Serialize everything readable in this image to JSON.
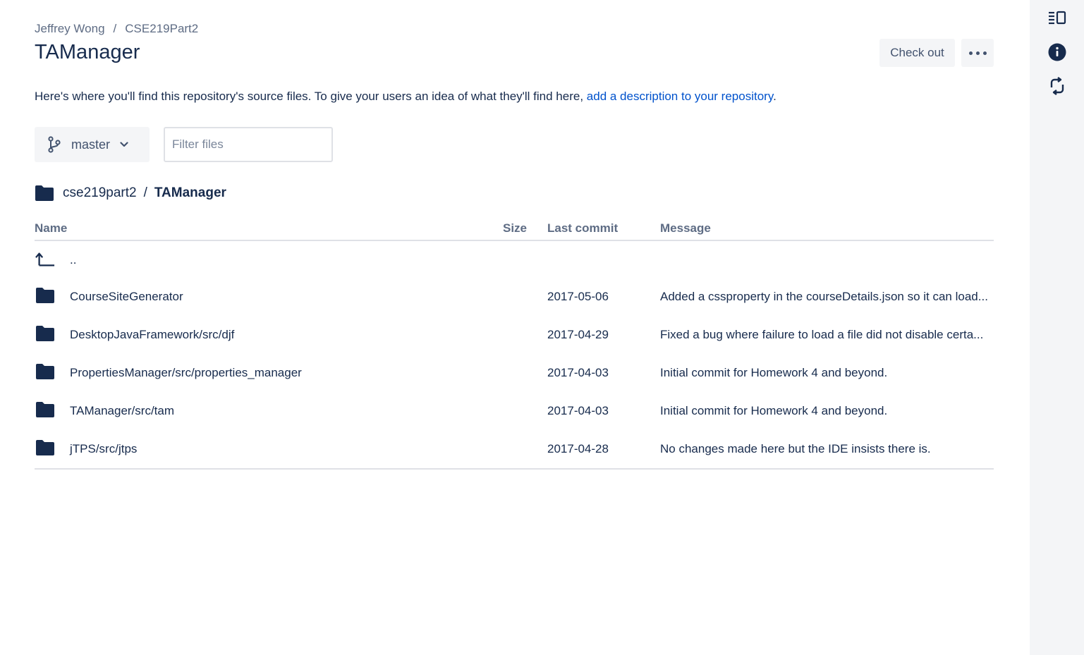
{
  "breadcrumb": {
    "owner": "Jeffrey Wong",
    "separator": "/",
    "project": "CSE219Part2"
  },
  "page_title": "TAManager",
  "actions": {
    "checkout_label": "Check out",
    "more_icon": "more-horizontal-icon"
  },
  "description": {
    "text": "Here's where you'll find this repository's source files. To give your users an idea of what they'll find here, ",
    "link": "add a description to your repository",
    "suffix": "."
  },
  "branch": {
    "icon": "branch-icon",
    "label": "master",
    "chevron": "chevron-down-icon"
  },
  "filter": {
    "placeholder": "Filter files",
    "value": ""
  },
  "path": {
    "root": "cse219part2",
    "separator": "/",
    "current": "TAManager"
  },
  "table": {
    "headers": {
      "name": "Name",
      "size": "Size",
      "last_commit": "Last commit",
      "message": "Message"
    },
    "parent_row": {
      "label": ".."
    },
    "rows": [
      {
        "name": "CourseSiteGenerator",
        "size": "",
        "date": "2017-05-06",
        "message": "Added a cssproperty in the courseDetails.json so it can load..."
      },
      {
        "name": "DesktopJavaFramework/src/djf",
        "size": "",
        "date": "2017-04-29",
        "message": "Fixed a bug where failure to load a file did not disable certa..."
      },
      {
        "name": "PropertiesManager/src/properties_manager",
        "size": "",
        "date": "2017-04-03",
        "message": "Initial commit for Homework 4 and beyond."
      },
      {
        "name": "TAManager/src/tam",
        "size": "",
        "date": "2017-04-03",
        "message": "Initial commit for Homework 4 and beyond."
      },
      {
        "name": "jTPS/src/jtps",
        "size": "",
        "date": "2017-04-28",
        "message": "No changes made here but the IDE insists there is."
      }
    ]
  },
  "right_rail": {
    "icons": [
      "sidebar-toggle-icon",
      "info-icon",
      "sync-icon"
    ]
  },
  "colors": {
    "link": "#0052cc",
    "text": "#172b4d",
    "muted": "#5e6c84",
    "rail_bg": "#f4f5f7",
    "button_bg": "#f4f5f7",
    "border": "#dfe1e6"
  }
}
